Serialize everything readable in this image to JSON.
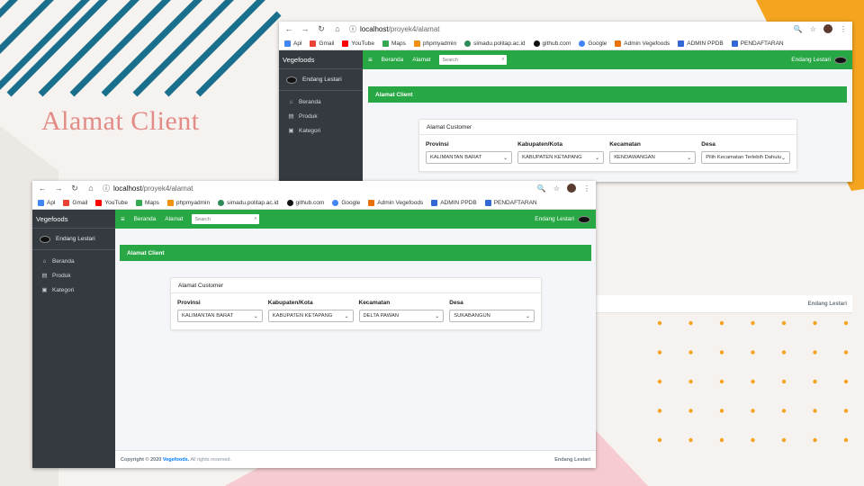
{
  "slide": {
    "title": "Alamat Client",
    "colors": {
      "title": "#e38b86",
      "stripe": "#1a6f8c",
      "accent": "#f4a41f",
      "pink": "#f6cbd1",
      "dots": "#f4a41f"
    }
  },
  "browser_back": {
    "url_host": "localhost",
    "url_path": "/proyek4/alamat",
    "bookmarks": [
      "Apl",
      "Gmail",
      "YouTube",
      "Maps",
      "phpmyadmin",
      "simadu.politap.ac.id",
      "github.com",
      "Google",
      "Admin Vegefoods",
      "ADMIN PPDB",
      "PENDAFTARAN"
    ]
  },
  "browser_front": {
    "url_host": "localhost",
    "url_path": "/proyek4/alamat",
    "bookmarks": [
      "Apl",
      "Gmail",
      "YouTube",
      "Maps",
      "phpmyadmin",
      "simadu.politap.ac.id",
      "github.com",
      "Google",
      "Admin Vegefoods",
      "ADMIN PPDB",
      "PENDAFTARAN"
    ]
  },
  "app": {
    "brand": "Vegefoods",
    "user_name": "Endang Lestari",
    "sidebar_items": [
      "Beranda",
      "Produk",
      "Kategori"
    ],
    "top_nav": [
      "Beranda",
      "Alamat"
    ],
    "search_placeholder": "Search",
    "page_title": "Alamat Client",
    "card_title": "Alamat Customer",
    "field_labels": [
      "Provinsi",
      "Kabupaten/Kota",
      "Kecamatan",
      "Desa"
    ],
    "footer_copyright_prefix": "Copyright © 2020",
    "footer_brand": "Vegefoods.",
    "footer_rights": "All rights reserved.",
    "footer_right": "Endang Lestari"
  },
  "back_values": [
    "KALIMANTAN BARAT",
    "KABUPATEN KETAPANG",
    "KENDAWANGAN",
    "Pilih Kecamatan Terlebih Dahulu"
  ],
  "front_values": [
    "KALIMANTAN BARAT",
    "KABUPATEN KETAPANG",
    "DELTA PAWAN",
    "SUKABANGUN"
  ],
  "fragment_footer_right": "Endang Lestari"
}
